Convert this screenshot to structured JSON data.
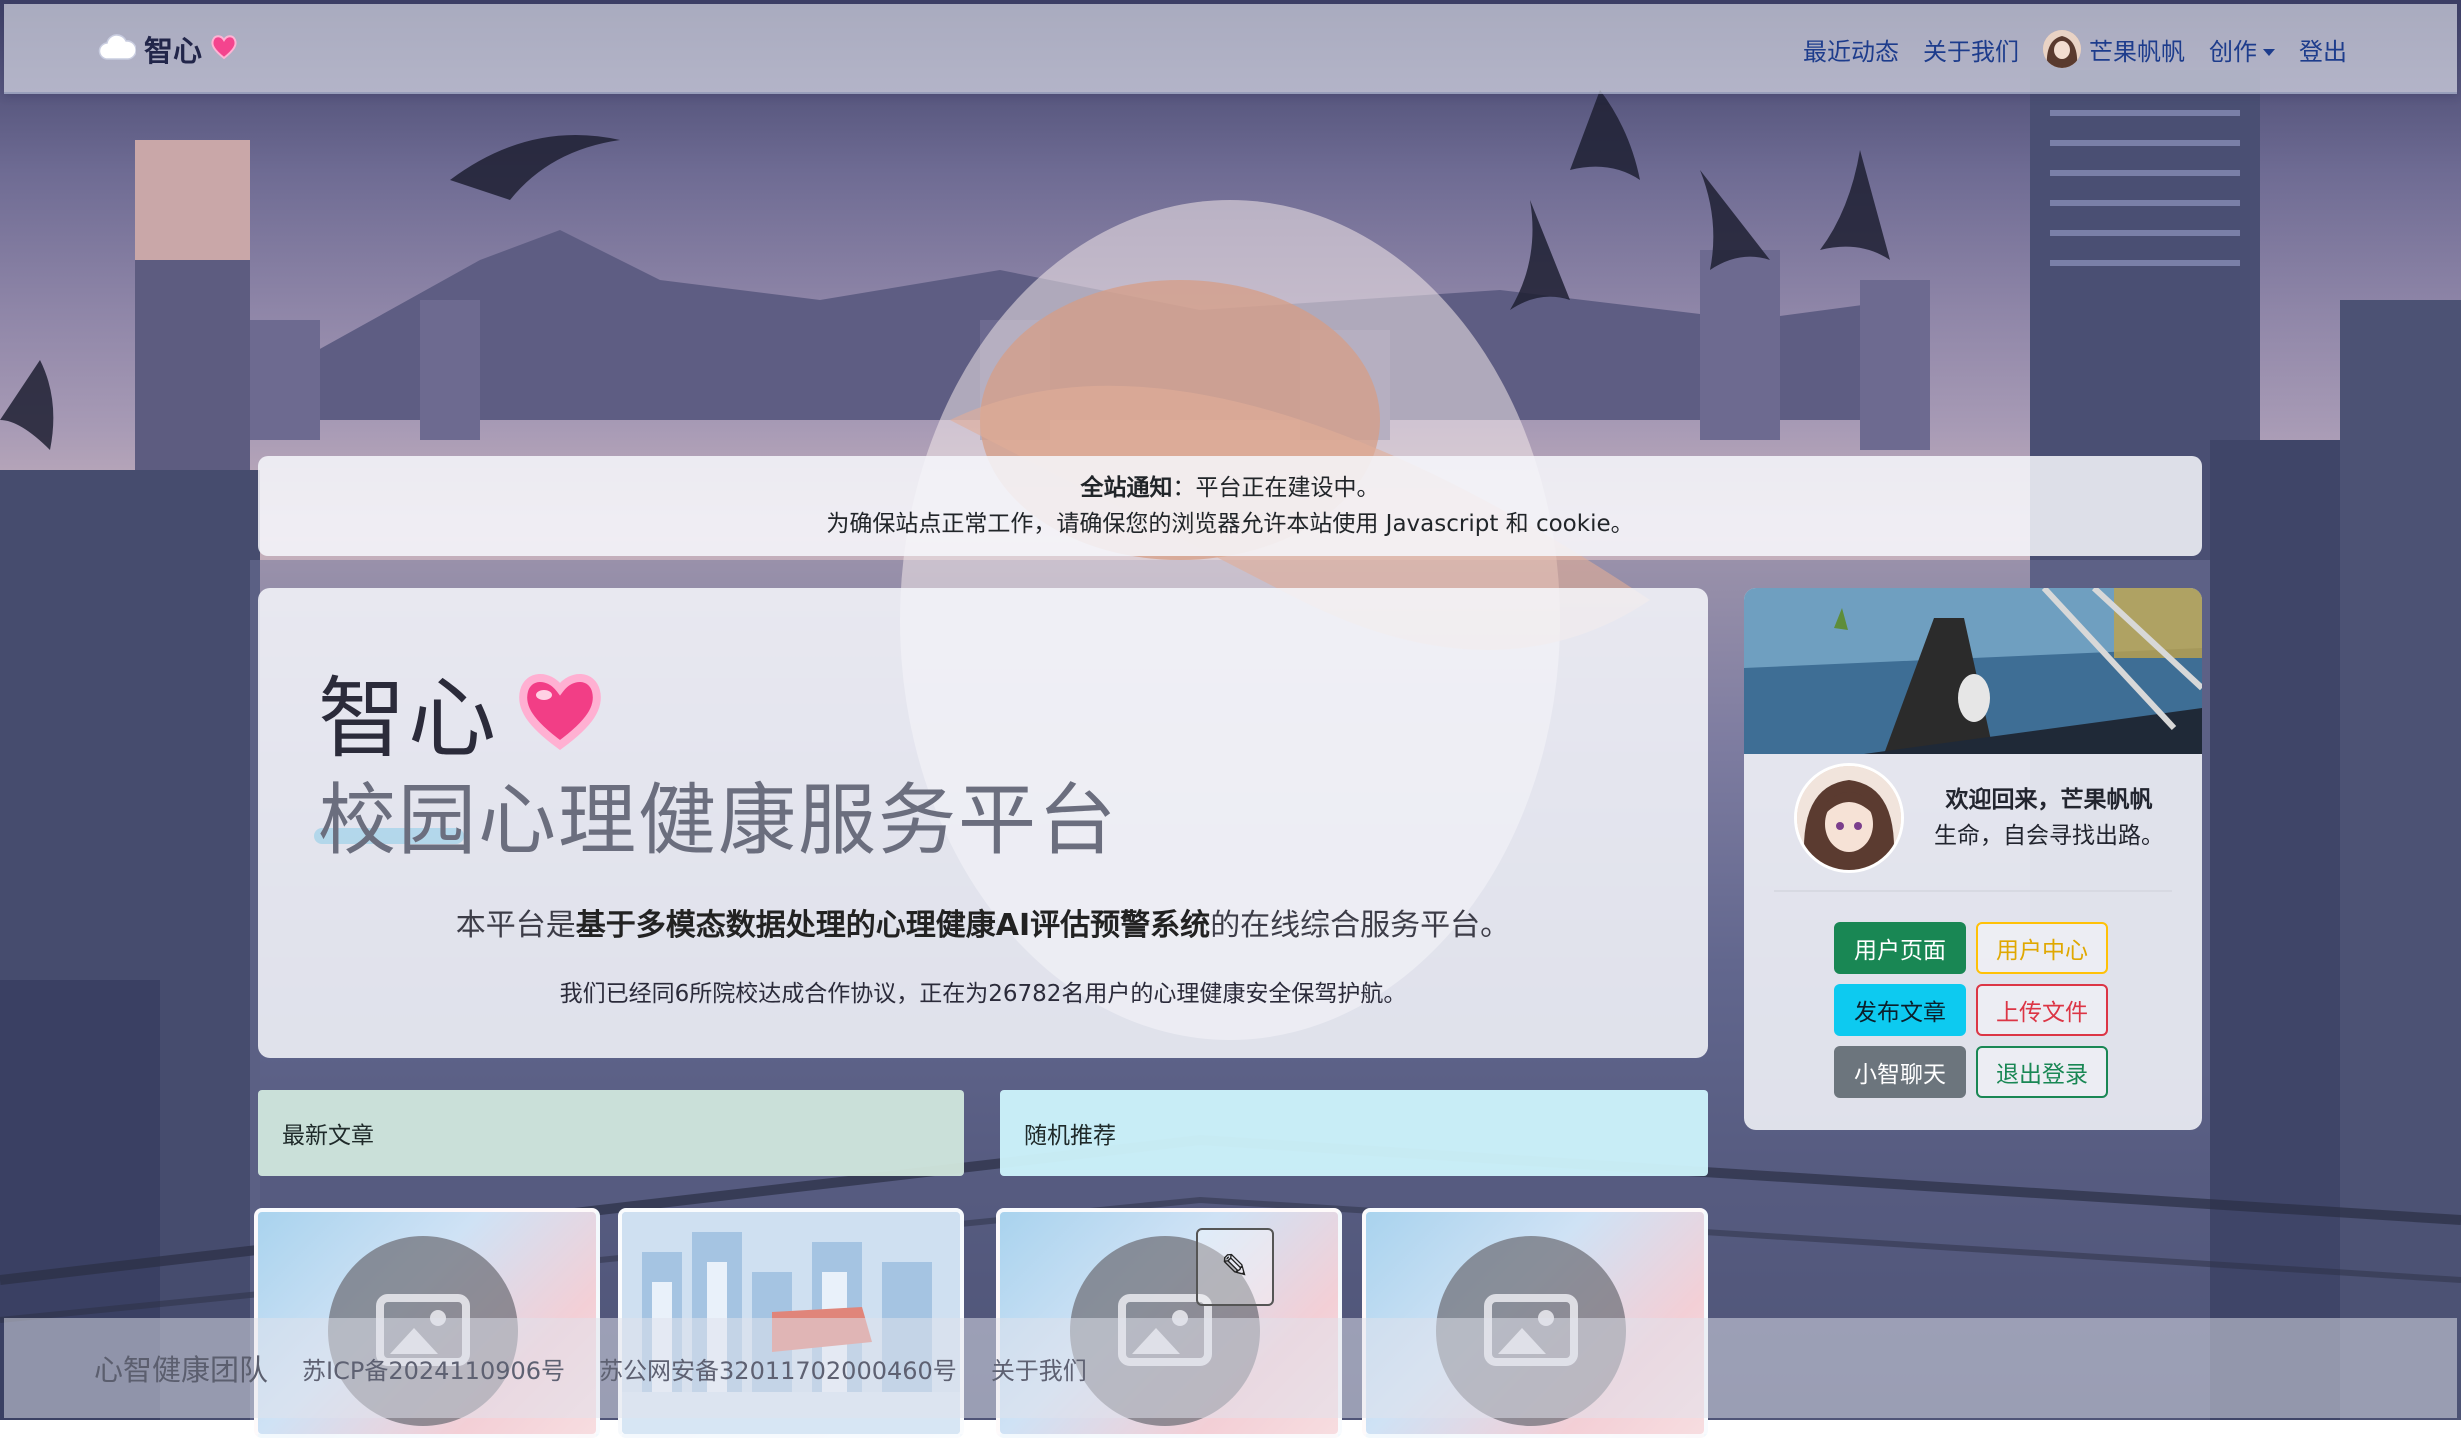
{
  "navbar": {
    "brand": "智心",
    "links": [
      "最近动态",
      "关于我们"
    ],
    "user_name": "芒果帆帆",
    "create_label": "创作",
    "logout_label": "登出"
  },
  "notice": {
    "title": "全站通知",
    "message": "：平台正在建设中。",
    "line2": "为确保站点正常工作，请确保您的浏览器允许本站使用 Javascript 和 cookie。"
  },
  "hero": {
    "title": "智心",
    "subtitle": "校园心理健康服务平台",
    "desc_pre": "本平台是",
    "desc_bold": "基于多模态数据处理的心理健康AI评估预警系统",
    "desc_post": "的在线综合服务平台。",
    "stat": "我们已经同6所院校达成合作协议，正在为26782名用户的心理健康安全保驾护航。"
  },
  "user_card": {
    "welcome": "欢迎回来，芒果帆帆",
    "motto": "生命，自会寻找出路。",
    "buttons": {
      "user_page": "用户页面",
      "user_center": "用户中心",
      "publish": "发布文章",
      "upload": "上传文件",
      "chat": "小智聊天",
      "logout": "退出登录"
    }
  },
  "sections": {
    "latest": "最新文章",
    "random": "随机推荐"
  },
  "footer": {
    "team": "心智健康团队",
    "icp": "苏ICP备2024110906号",
    "police": "苏公网安备32011702000460号",
    "about": "关于我们"
  }
}
